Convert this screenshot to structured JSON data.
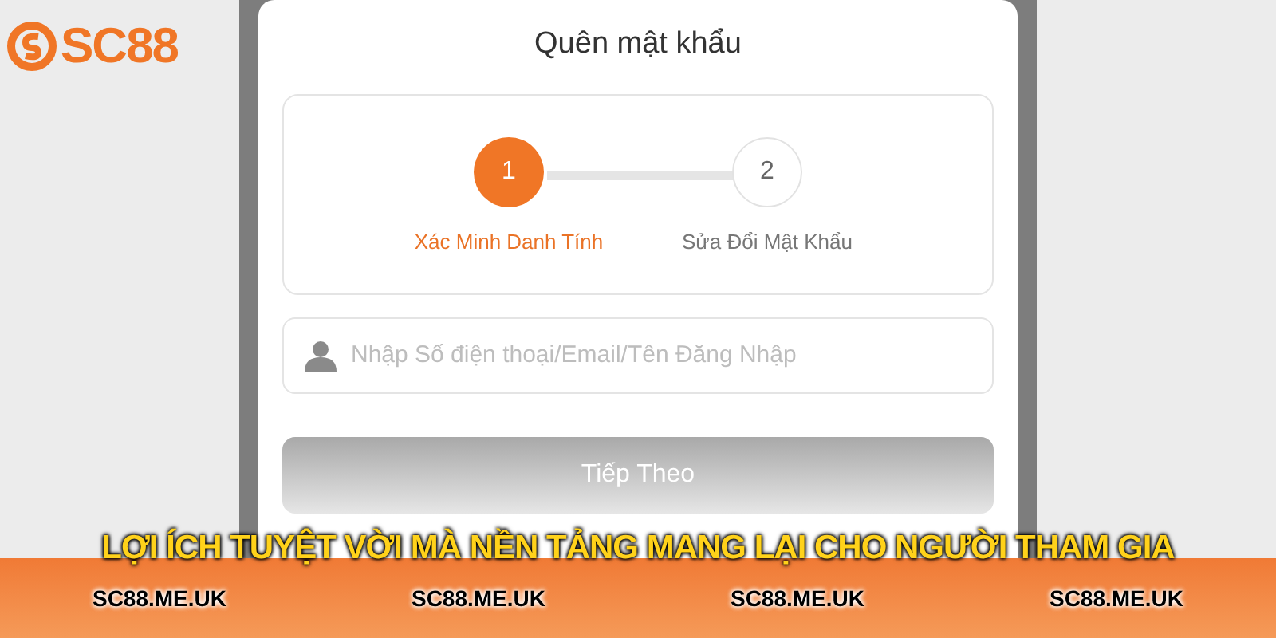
{
  "logo": {
    "text": "SC88"
  },
  "title": "Quên mật khẩu",
  "steps": [
    {
      "number": "1",
      "label": "Xác Minh Danh Tính",
      "selected": true
    },
    {
      "number": "2",
      "label": "Sửa Đổi Mật Khẩu",
      "selected": false
    }
  ],
  "input": {
    "placeholder": "Nhập Số điện thoại/Email/Tên Đăng Nhập"
  },
  "button": {
    "label": "Tiếp Theo",
    "disabled": true
  },
  "caption": "LỢI ÍCH TUYỆT VỜI MÀ NỀN TẢNG MANG LẠI CHO NGƯỜI THAM GIA",
  "footer_links": [
    "SC88.ME.UK",
    "SC88.ME.UK",
    "SC88.ME.UK",
    "SC88.ME.UK"
  ]
}
